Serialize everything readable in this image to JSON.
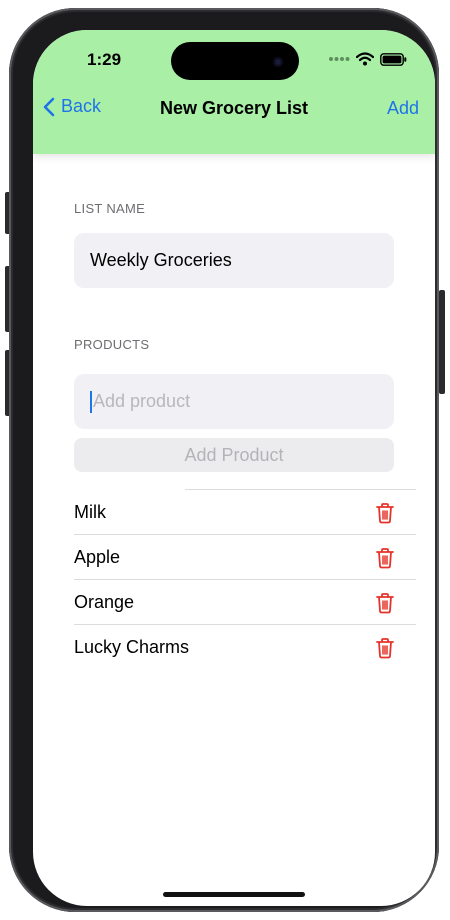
{
  "status_bar": {
    "time": "1:29",
    "icons": [
      "signal-dots-icon",
      "wifi-icon",
      "battery-icon"
    ]
  },
  "nav": {
    "back_label": "Back",
    "title": "New Grocery List",
    "add_label": "Add",
    "bar_color": "#a9f0a6",
    "accent_color": "#1e74e8"
  },
  "list_name": {
    "header": "LIST NAME",
    "value": "Weekly Groceries"
  },
  "products": {
    "header": "PRODUCTS",
    "input_placeholder": "Add product",
    "add_button_label": "Add Product",
    "items": [
      {
        "name": "Milk"
      },
      {
        "name": "Apple"
      },
      {
        "name": "Orange"
      },
      {
        "name": "Lucky Charms"
      }
    ],
    "delete_icon": "trash-icon",
    "delete_color": "#e5332a"
  }
}
